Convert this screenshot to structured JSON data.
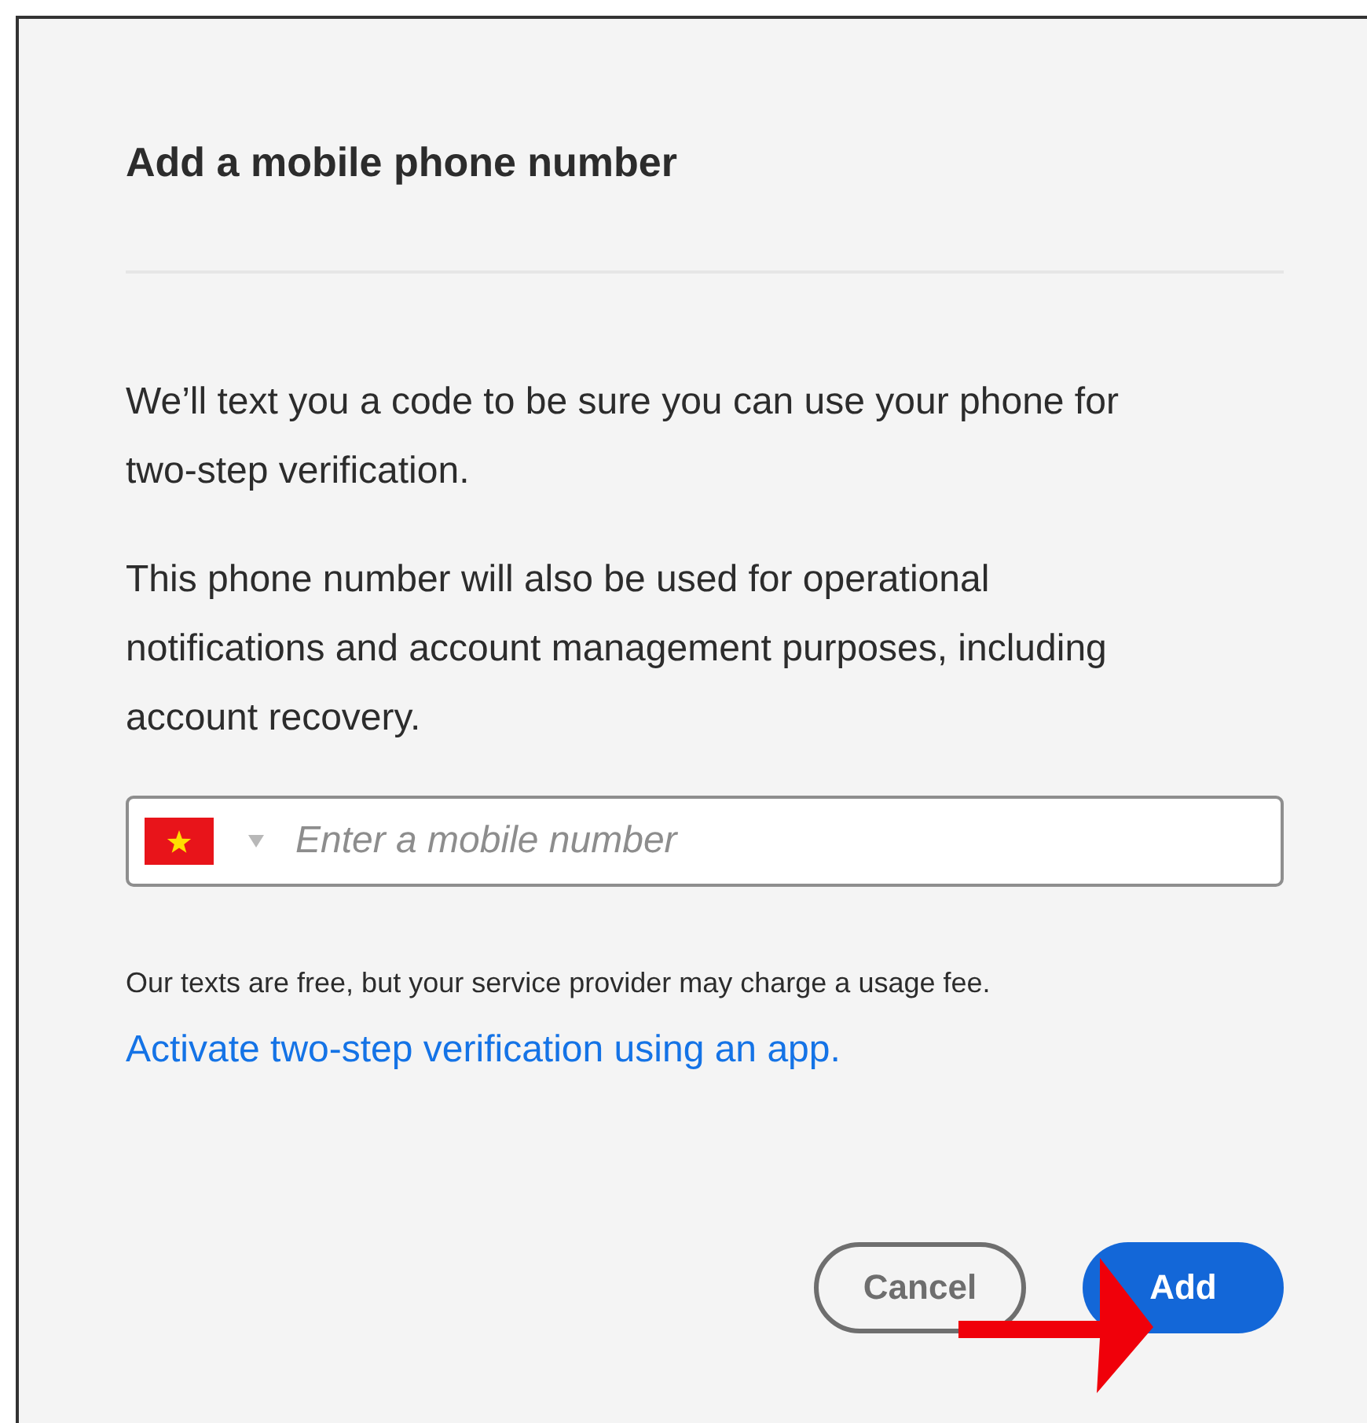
{
  "dialog": {
    "title": "Add a mobile phone number",
    "paragraphs": [
      "We’ll text you a code to be sure you can use your phone for two-step verification.",
      "This phone number will also be used for operational notifications and account management purposes, including account recovery."
    ],
    "phone_field": {
      "placeholder": "Enter a mobile number"
    },
    "note": "Our texts are free, but your service provider may charge a usage fee.",
    "link": "Activate two-step verification using an app.",
    "buttons": [
      {
        "label": "Cancel",
        "kind": "secondary"
      },
      {
        "label": "Add",
        "kind": "primary"
      }
    ]
  }
}
